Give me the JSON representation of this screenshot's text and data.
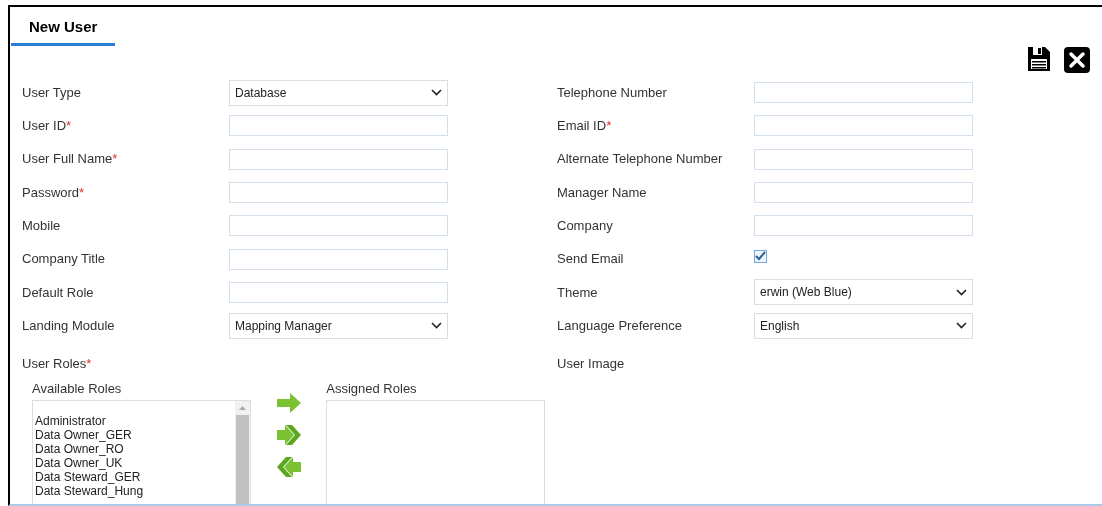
{
  "tab": {
    "label": "New User",
    "selected": true
  },
  "left_fields": [
    {
      "label": "User Type",
      "kind": "select",
      "value": "Database"
    },
    {
      "label": "User ID",
      "required_mark": "*",
      "kind": "text"
    },
    {
      "label": "User Full Name",
      "required_mark": "*",
      "kind": "text"
    },
    {
      "label": "Password",
      "required_mark": "*",
      "kind": "text"
    },
    {
      "label": "Mobile",
      "kind": "text"
    },
    {
      "label": "Company Title",
      "kind": "text"
    },
    {
      "label": "Default Role",
      "kind": "text"
    },
    {
      "label": "Landing Module",
      "kind": "select",
      "value": "Mapping Manager"
    }
  ],
  "right_fields": [
    {
      "label": "Telephone Number",
      "kind": "text"
    },
    {
      "label": "Email ID",
      "required_mark": "*",
      "kind": "text"
    },
    {
      "label": "Alternate Telephone Number",
      "kind": "text"
    },
    {
      "label": "Manager Name",
      "kind": "text"
    },
    {
      "label": "Company",
      "kind": "text"
    },
    {
      "label": "Send Email",
      "kind": "checkbox",
      "checked": true
    },
    {
      "label": "Theme",
      "kind": "select",
      "value": "erwin (Web Blue)"
    },
    {
      "label": "Language Preference",
      "kind": "select",
      "value": "English"
    }
  ],
  "user_roles": {
    "label": "User Roles",
    "required_mark": "*",
    "available_label": "Available Roles",
    "available": [
      "Administrator",
      "Data Owner_GER",
      "Data Owner_RO",
      "Data Owner_UK",
      "Data Steward_GER",
      "Data Steward_Hung"
    ],
    "assigned_label": "Assigned Roles"
  },
  "user_image": {
    "label": "User Image"
  }
}
